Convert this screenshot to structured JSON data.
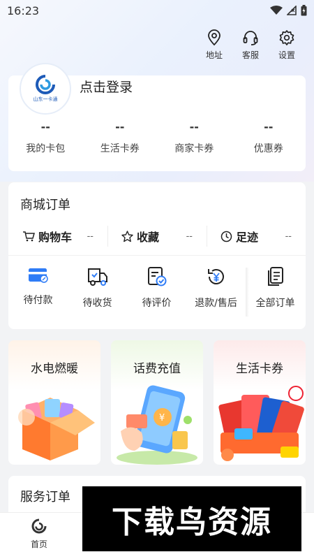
{
  "status_bar": {
    "time": "16:23"
  },
  "header_actions": [
    {
      "label": "地址",
      "icon": "location-pin-icon"
    },
    {
      "label": "客服",
      "icon": "headset-icon"
    },
    {
      "label": "设置",
      "icon": "gear-icon"
    }
  ],
  "user": {
    "logo_text": "山东一卡通",
    "login_label": "点击登录",
    "wallet": [
      {
        "value": "--",
        "label": "我的卡包"
      },
      {
        "value": "--",
        "label": "生活卡券"
      },
      {
        "value": "--",
        "label": "商家卡券"
      },
      {
        "value": "--",
        "label": "优惠券"
      }
    ]
  },
  "orders": {
    "title": "商城订单",
    "quick": [
      {
        "label": "购物车",
        "count": "--",
        "icon": "cart-icon"
      },
      {
        "label": "收藏",
        "count": "--",
        "icon": "star-icon"
      },
      {
        "label": "足迹",
        "count": "--",
        "icon": "clock-icon"
      }
    ],
    "statuses": [
      {
        "label": "待付款",
        "icon": "card-payment-icon"
      },
      {
        "label": "待收货",
        "icon": "truck-icon"
      },
      {
        "label": "待评价",
        "icon": "review-icon"
      },
      {
        "label": "退款/售后",
        "icon": "refund-icon"
      },
      {
        "label": "全部订单",
        "icon": "orders-list-icon"
      }
    ]
  },
  "promos": [
    {
      "title": "水电燃暖"
    },
    {
      "title": "话费充值"
    },
    {
      "title": "生活卡券"
    }
  ],
  "service": {
    "title": "服务订单"
  },
  "tab_bar": {
    "home_label": "首页"
  },
  "watermark": {
    "text": "下载鸟资源"
  },
  "colors": {
    "accent": "#2f7cf6",
    "brand": "#1e5bb8"
  }
}
